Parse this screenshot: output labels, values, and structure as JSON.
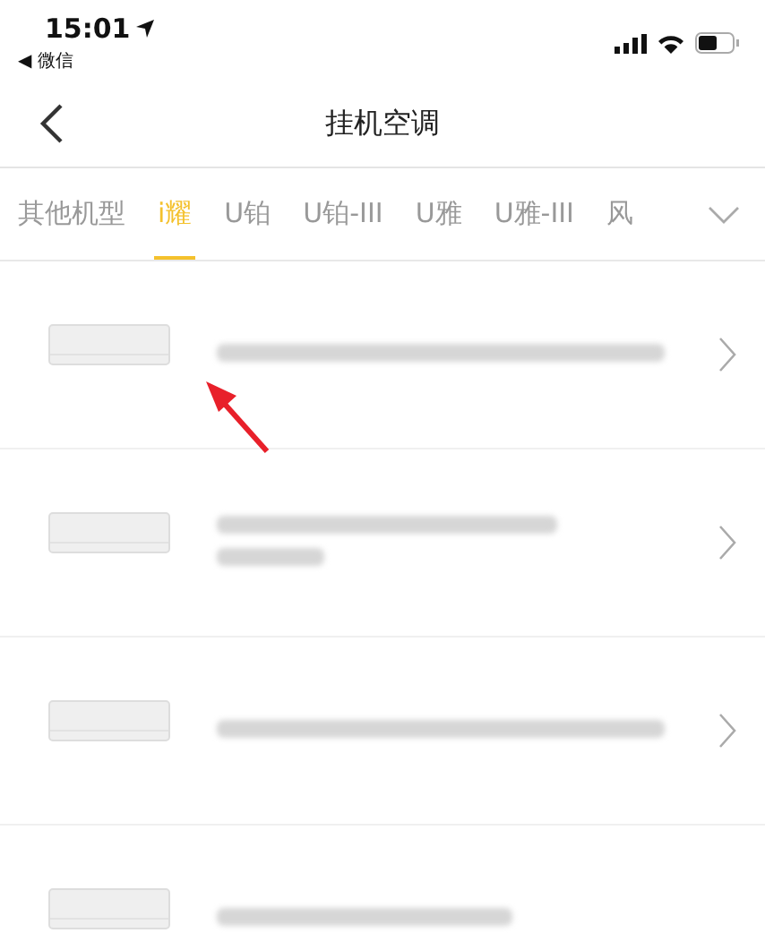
{
  "status_bar": {
    "time": "15:01",
    "back_app": "◀ 微信"
  },
  "nav": {
    "title": "挂机空调"
  },
  "tabs": [
    {
      "label": "其他机型",
      "selected": false
    },
    {
      "label": "i耀",
      "selected": true
    },
    {
      "label": "U铂",
      "selected": false
    },
    {
      "label": "U铂-III",
      "selected": false
    },
    {
      "label": "U雅",
      "selected": false
    },
    {
      "label": "U雅-III",
      "selected": false
    },
    {
      "label": "风",
      "selected": false
    }
  ],
  "products": [
    {
      "kind": "one-line",
      "chevron": true
    },
    {
      "kind": "two-line",
      "chevron": true
    },
    {
      "kind": "one-line",
      "chevron": true
    },
    {
      "kind": "short",
      "chevron": false
    }
  ],
  "annotation_arrow": true
}
